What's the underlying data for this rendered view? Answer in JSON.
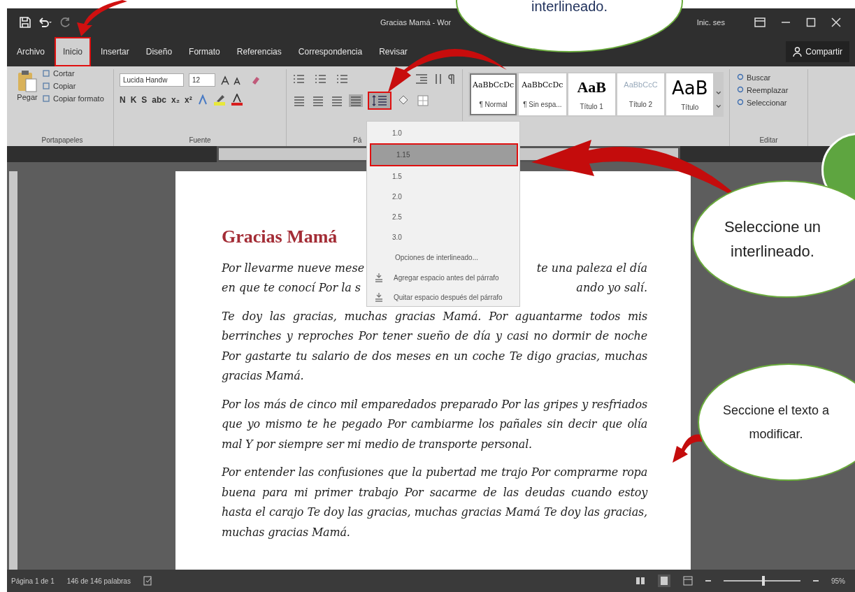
{
  "window": {
    "title": "Gracias Mamá - Wor",
    "account": "Inic. ses"
  },
  "tabs": [
    {
      "label": "Archivo",
      "selected": false
    },
    {
      "label": "Inicio",
      "selected": true
    },
    {
      "label": "Insertar",
      "selected": false
    },
    {
      "label": "Diseño",
      "selected": false
    },
    {
      "label": "Formato",
      "selected": false
    },
    {
      "label": "Referencias",
      "selected": false
    },
    {
      "label": "Correspondencia",
      "selected": false
    },
    {
      "label": "Revisar",
      "selected": false
    }
  ],
  "share_button": "Compartir",
  "ribbon": {
    "clipboard": {
      "paste": "Pegar",
      "items": [
        "Cortar",
        "Copiar",
        "Copiar formato"
      ],
      "group": "Portapapeles"
    },
    "font": {
      "name": "Lucida Handw",
      "size": "12",
      "format_buttons": [
        "N",
        "K",
        "S",
        "abc",
        "x₂",
        "x²"
      ],
      "group": "Fuente"
    },
    "paragraph": {
      "group": "Pá"
    },
    "styles": [
      {
        "sample": "AaBbCcDc",
        "name": "¶ Normal",
        "kind": "body",
        "selected": true
      },
      {
        "sample": "AaBbCcDc",
        "name": "¶ Sin espa...",
        "kind": "body",
        "selected": false
      },
      {
        "sample": "AaB",
        "name": "Título 1",
        "kind": "heading",
        "selected": false
      },
      {
        "sample": "AaBbCcC",
        "name": "Título 2",
        "kind": "subtle",
        "selected": false
      },
      {
        "sample": "AaB",
        "name": "Título",
        "kind": "title",
        "selected": false
      }
    ],
    "editing": {
      "items": [
        "Buscar",
        "Reemplazar",
        "Seleccionar"
      ],
      "group": "Editar"
    }
  },
  "line_spacing_menu": {
    "options": [
      {
        "label": "1.0",
        "selected": false
      },
      {
        "label": "1.15",
        "selected": true
      },
      {
        "label": "1.5",
        "selected": false
      },
      {
        "label": "2.0",
        "selected": false
      },
      {
        "label": "2.5",
        "selected": false
      },
      {
        "label": "3.0",
        "selected": false
      }
    ],
    "options_link": "Opciones de interlineado...",
    "actions": [
      "Agregar espacio antes del párrafo",
      "Quitar espacio después del párrafo"
    ]
  },
  "document": {
    "title": "Gracias Mamá",
    "first_paragraph_lines": [
      [
        "Por llevarme nueve mese",
        "te una paleza el día"
      ],
      [
        "en que te conocí Por la s",
        "ando yo salí."
      ]
    ],
    "paragraphs": [
      "Te doy las gracias, muchas gracias Mamá. Por aguantarme todos mis berrinches y reproches Por tener sueño de día y casi no dormir de noche Por gastarte tu salario de dos meses en un coche Te digo gracias, muchas gracias Mamá.",
      "Por los más de cinco mil emparedados preparado Por las gripes y resfriados que yo mismo te he pegado Por cambiarme los pañales sin decir que olía mal Y por siempre ser mi medio de transporte personal.",
      "Por entender las confusiones que la pubertad me trajo Por comprarme ropa buena para mi primer trabajo Por sacarme de las deudas cuando estoy hasta el carajo Te doy las gracias, muchas gracias Mamá Te doy las gracias, muchas gracias Mamá."
    ]
  },
  "status_bar": {
    "page": "Página 1 de 1",
    "words": "146 de 146 palabras",
    "zoom": "95%"
  },
  "zoom_slider": {
    "level": 0.5
  },
  "callouts": [
    {
      "text": "interlineado.",
      "kind": "top"
    },
    {
      "text": "Seleccione un interlineado.",
      "kind": "right"
    },
    {
      "text": "Seccione el texto a modificar.",
      "kind": "lower"
    }
  ]
}
